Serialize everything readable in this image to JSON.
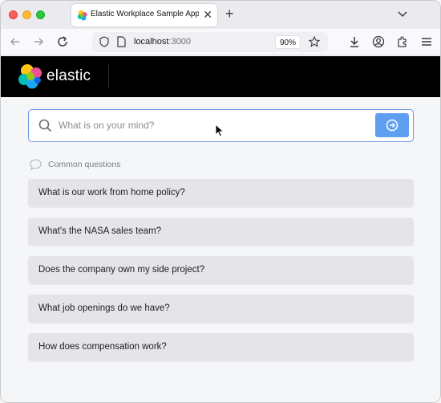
{
  "browser": {
    "tab_title": "Elastic Workplace Sample App",
    "url_host": "localhost",
    "url_port": ":3000",
    "zoom": "90%"
  },
  "header": {
    "logo_text": "elastic"
  },
  "search": {
    "placeholder": "What is on your mind?",
    "value": ""
  },
  "common_questions": {
    "label": "Common questions",
    "items": [
      "What is our work from home policy?",
      "What's the NASA sales team?",
      "Does the company own my side project?",
      "What job openings do we have?",
      "How does compensation work?"
    ]
  },
  "colors": {
    "accent": "#5e9ff2",
    "header_bg": "#000000",
    "question_bg": "#e5e5e7"
  },
  "icons": {
    "search": "search-icon",
    "submit": "arrow-right-circle-icon",
    "common_questions": "chat-bubble-icon"
  }
}
